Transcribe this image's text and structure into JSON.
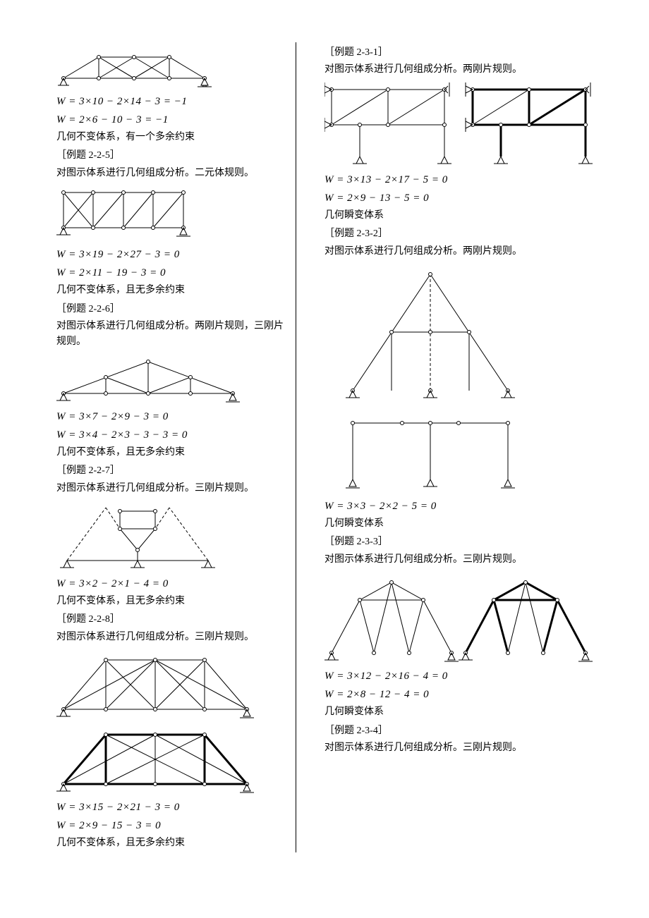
{
  "left": {
    "f1a": "W = 3×10 − 2×14 − 3 = −1",
    "f1b": "W = 2×6 − 10 − 3 = −1",
    "t1": "几何不变体系，有一个多余约束",
    "l1": "［例题 2-2-5］",
    "p1": "对图示体系进行几何组成分析。二元体规则。",
    "f2a": "W = 3×19 − 2×27 − 3 = 0",
    "f2b": "W = 2×11 − 19 − 3 = 0",
    "t2": "几何不变体系，且无多余约束",
    "l2": "［例题 2-2-6］",
    "p2": "对图示体系进行几何组成分析。两刚片规则，三刚片规则。",
    "f3a": "W = 3×7 − 2×9 − 3 = 0",
    "f3b": "W = 3×4 − 2×3 − 3 − 3 = 0",
    "t3": "几何不变体系，且无多余约束",
    "l3": "［例题 2-2-7］",
    "p3": "对图示体系进行几何组成分析。三刚片规则。",
    "f4a": "W = 3×2 − 2×1 − 4 = 0",
    "t4": "几何不变体系，且无多余约束",
    "l4": "［例题 2-2-8］",
    "p4": "对图示体系进行几何组成分析。三刚片规则。",
    "f5a": "W = 3×15 − 2×21 − 3 = 0",
    "f5b": "W = 2×9 − 15 − 3 = 0",
    "t5": "几何不变体系，且无多余约束"
  },
  "right": {
    "l1": "［例题 2-3-1］",
    "p1": "对图示体系进行几何组成分析。两刚片规则。",
    "f1a": "W = 3×13 − 2×17 − 5 = 0",
    "f1b": "W = 2×9 − 13 − 5 = 0",
    "t1": "几何瞬变体系",
    "l2": "［例题 2-3-2］",
    "p2": "对图示体系进行几何组成分析。两刚片规则。",
    "f2a": "W = 3×3 − 2×2 − 5 = 0",
    "t2": "几何瞬变体系",
    "l3": "［例题 2-3-3］",
    "p3": "对图示体系进行几何组成分析。三刚片规则。",
    "f3a": "W = 3×12 − 2×16 − 4 = 0",
    "f3b": "W = 2×8 − 12 − 4 = 0",
    "t3": "几何瞬变体系",
    "l4": "［例题 2-3-4］",
    "p4": "对图示体系进行几何组成分析。三刚片规则。"
  }
}
